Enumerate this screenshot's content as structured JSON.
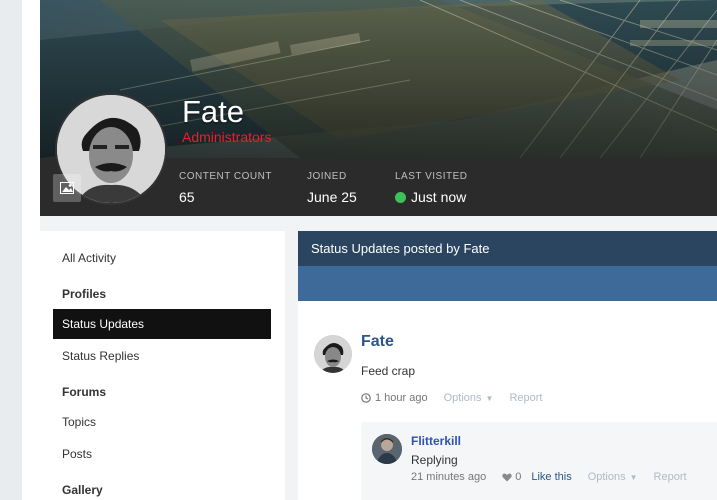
{
  "profile": {
    "name": "Fate",
    "group": "Administrators",
    "stats": [
      {
        "label": "Content Count",
        "value": "65"
      },
      {
        "label": "Joined",
        "value": "June 25"
      },
      {
        "label": "Last Visited",
        "value": "Just now"
      }
    ]
  },
  "sidebar": {
    "items": [
      {
        "label": "All Activity"
      },
      {
        "label": "Profiles"
      },
      {
        "label": "Status Updates"
      },
      {
        "label": "Status Replies"
      },
      {
        "label": "Forums"
      },
      {
        "label": "Topics"
      },
      {
        "label": "Posts"
      },
      {
        "label": "Gallery"
      }
    ]
  },
  "main": {
    "title": "Status Updates posted by Fate",
    "post": {
      "author": "Fate",
      "text": "Feed crap",
      "time": "1 hour ago",
      "options": "Options",
      "report": "Report"
    },
    "reply": {
      "author": "Flitterkill",
      "text": "Replying",
      "time": "21 minutes ago",
      "likes": "0",
      "like_label": "Like this",
      "options": "Options",
      "report": "Report"
    }
  },
  "colors": {
    "group_red": "#e8202a",
    "online_green": "#3ec15a",
    "title_bar": "#2b4560",
    "band_blue": "#3d6a99",
    "author_blue": "#2c5687"
  }
}
